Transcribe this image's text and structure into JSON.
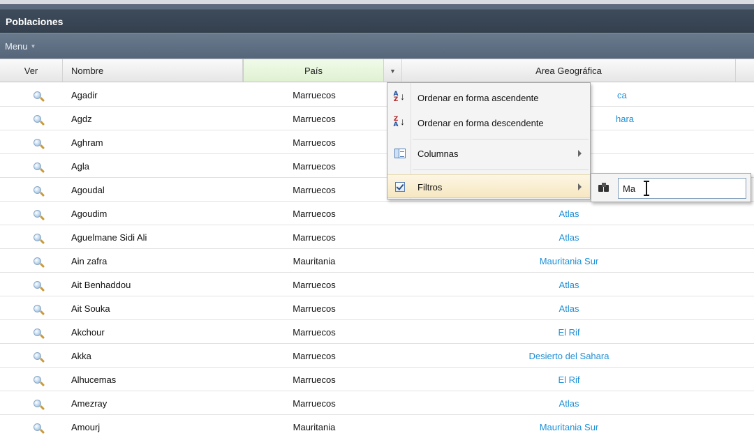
{
  "window": {
    "title": "Poblaciones"
  },
  "menu": {
    "label": "Menu"
  },
  "columns": {
    "ver": "Ver",
    "nombre": "Nombre",
    "pais": "País",
    "area": "Area Geográfica"
  },
  "rows": [
    {
      "nombre": "Agadir",
      "pais": "Marruecos",
      "area": ""
    },
    {
      "nombre": "Agdz",
      "pais": "Marruecos",
      "area": ""
    },
    {
      "nombre": "Aghram",
      "pais": "Marruecos",
      "area": ""
    },
    {
      "nombre": "Agla",
      "pais": "Marruecos",
      "area": ""
    },
    {
      "nombre": "Agoudal",
      "pais": "Marruecos",
      "area": ""
    },
    {
      "nombre": "Agoudim",
      "pais": "Marruecos",
      "area": "Atlas"
    },
    {
      "nombre": "Aguelmane Sidi Ali",
      "pais": "Marruecos",
      "area": "Atlas"
    },
    {
      "nombre": "Ain zafra",
      "pais": "Mauritania",
      "area": "Mauritania Sur"
    },
    {
      "nombre": "Ait Benhaddou",
      "pais": "Marruecos",
      "area": "Atlas"
    },
    {
      "nombre": "Ait Souka",
      "pais": "Marruecos",
      "area": "Atlas"
    },
    {
      "nombre": "Akchour",
      "pais": "Marruecos",
      "area": "El Rif"
    },
    {
      "nombre": "Akka",
      "pais": "Marruecos",
      "area": "Desierto del Sahara"
    },
    {
      "nombre": "Alhucemas",
      "pais": "Marruecos",
      "area": "El Rif"
    },
    {
      "nombre": "Amezray",
      "pais": "Marruecos",
      "area": "Atlas"
    },
    {
      "nombre": "Amourj",
      "pais": "Mauritania",
      "area": "Mauritania Sur"
    }
  ],
  "partial_area_text": {
    "row0": "ca",
    "row1": "hara"
  },
  "context_menu": {
    "sort_asc": "Ordenar en forma ascendente",
    "sort_desc": "Ordenar en forma descendente",
    "columns": "Columnas",
    "filters": "Filtros"
  },
  "filter": {
    "value": "Ma"
  },
  "colors": {
    "link": "#1e8fd6",
    "title_bar": "#3e4b5b",
    "highlight": "#f6e7c1"
  }
}
